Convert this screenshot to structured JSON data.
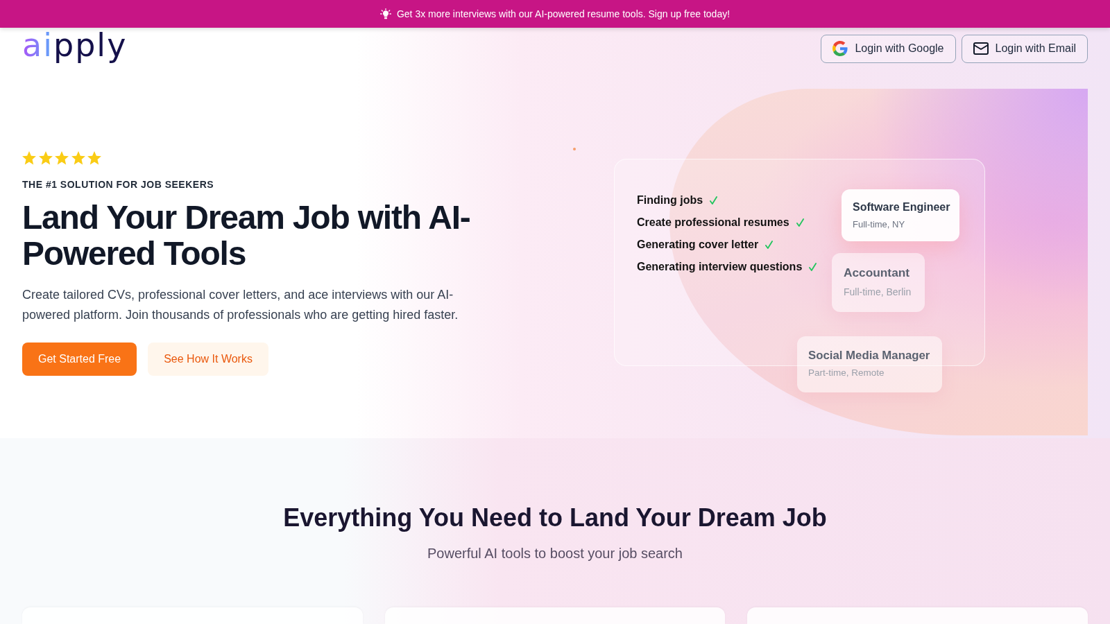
{
  "banner": {
    "text": "Get 3x more interviews with our AI-powered resume tools. Sign up free today!"
  },
  "header": {
    "logo": "aipply",
    "buttons": [
      {
        "kind": "google",
        "label": "Login with Google"
      },
      {
        "kind": "email",
        "label": "Login with Email"
      }
    ]
  },
  "hero": {
    "stars": 5,
    "eyebrow": "THE #1 SOLUTION FOR JOB SEEKERS",
    "title": "Land Your Dream Job with AI-Powered Tools",
    "description": "Create tailored CVs, professional cover letters, and ace interviews with our AI-powered platform. Join thousands of professionals who are getting hired faster.",
    "buttons": [
      {
        "kind": "primary",
        "label": "Get Started Free"
      },
      {
        "kind": "secondary",
        "label": "See How It Works"
      }
    ],
    "checklist": [
      {
        "label": "Finding jobs",
        "checked": true
      },
      {
        "label": "Create professional resumes",
        "checked": true
      },
      {
        "label": "Generating cover letter",
        "checked": true
      },
      {
        "label": "Generating interview questions",
        "checked": true
      }
    ],
    "job_cards": [
      {
        "title": "Software Engineer",
        "details": "Full-time, NY",
        "active": true
      },
      {
        "title": "Accountant",
        "details": "Full-time, Berlin",
        "active": false
      },
      {
        "title": "Social Media Manager",
        "details": "Part-time, Remote",
        "active": false
      }
    ]
  },
  "features": {
    "title": "Everything You Need to Land Your Dream Job",
    "subtitle": "Powerful AI tools to boost your job search"
  }
}
